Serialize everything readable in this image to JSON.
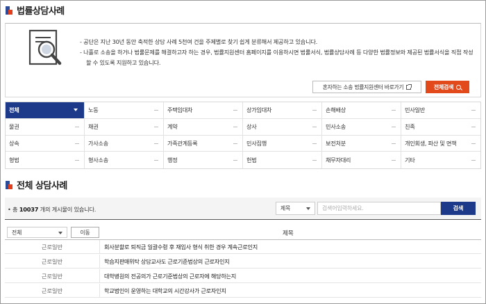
{
  "page": {
    "title": "법률상담사례",
    "section_title": "전체 상담사례"
  },
  "info": {
    "lines": [
      "- 공단은 지난 30년 동안 축적한 상담 사례 5천여 건을 주제별로 찾기 쉽게 분류해서 제공하고 있습니다.",
      "- 나홀로 소송을 하거나 법률문제를 해결하고자 하는 경우, 법률지원센터 홈페이지를 이용하시면 법률서식, 법률상담사례 등 다양한 법률정보와 제공된 법률서식을 직접 작성 할 수 있도록 지원하고 있습니다."
    ],
    "link_button": "혼자하는 소송 법률지원센터 바로가기",
    "search_all_button": "전체검색"
  },
  "categories": [
    "전체",
    "노동",
    "주택임대차",
    "상가임대차",
    "손해배상",
    "민사일반",
    "물권",
    "채권",
    "계약",
    "상사",
    "민사소송",
    "친족",
    "상속",
    "가사소송",
    "가족관계등록",
    "민사집행",
    "보전처분",
    "개인회생, 파산 및 면책",
    "형법",
    "형사소송",
    "행정",
    "헌법",
    "채무자대리",
    "기타"
  ],
  "search": {
    "count_prefix": "• 총",
    "count": "10037",
    "count_suffix": "개의 게시물이 있습니다.",
    "field_selected": "제목",
    "placeholder": "검색어입력하세요.",
    "button": "검색"
  },
  "table": {
    "filter_selected": "전체",
    "move_button": "이동",
    "title_header": "제목",
    "rows": [
      {
        "category": "근로일반",
        "title": "회사분할로 퇴직금 일괄수령 후 재입사 형식 취한 경우 계속근로인지"
      },
      {
        "category": "근로일반",
        "title": "학습지판매위탁 상담교사도 근로기준법상의 근로자인지"
      },
      {
        "category": "근로일반",
        "title": "대학병원의 전공의가 근로기준법상의 근로자에 해당하는지"
      },
      {
        "category": "근로일반",
        "title": "학교법인이 운영하는 대학교의 시간강사가 근로자인지"
      }
    ]
  },
  "colors": {
    "navy": "#1d3a8a",
    "orange": "#e24a1c"
  },
  "icons": {
    "title_mark": "square-mark-icon",
    "info": "document-magnifier-icon",
    "external": "external-link-icon",
    "search": "search-icon"
  }
}
